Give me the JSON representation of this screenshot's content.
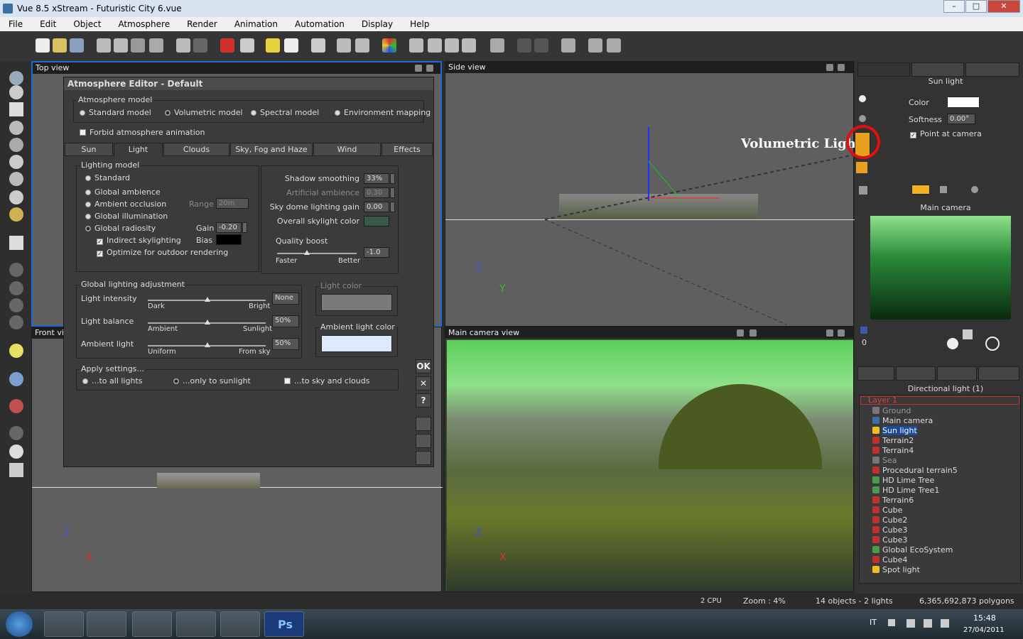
{
  "window": {
    "title": "Vue 8.5 xStream - Futuristic City 6.vue",
    "min": "–",
    "max": "□",
    "close": "✕"
  },
  "menu": [
    "File",
    "Edit",
    "Object",
    "Atmosphere",
    "Render",
    "Animation",
    "Automation",
    "Display",
    "Help"
  ],
  "viewports": {
    "top": "Top view",
    "side": "Side view",
    "front": "Front vie",
    "camera": "Main camera view"
  },
  "axes": {
    "z": "Z",
    "x": "X",
    "y": "Y"
  },
  "dialog": {
    "title": "Atmosphere Editor - Default",
    "model_group": "Atmosphere model",
    "models": [
      "Standard model",
      "Volumetric model",
      "Spectral model",
      "Environment mapping"
    ],
    "forbid": "Forbid atmosphere animation",
    "tabs": [
      "Sun",
      "Light",
      "Clouds",
      "Sky, Fog and Haze",
      "Wind",
      "Effects"
    ],
    "lighting_model": "Lighting model",
    "lm_options": [
      "Standard",
      "Global ambience",
      "Ambient occlusion",
      "Global illumination",
      "Global radiosity"
    ],
    "range_label": "Range",
    "range_value": "20m",
    "gain_label": "Gain",
    "gain_value": "-0.20",
    "indirect": "Indirect skylighting",
    "bias_label": "Bias",
    "optimize": "Optimize for outdoor rendering",
    "shadow_label": "Shadow smoothing",
    "shadow_value": "33%",
    "artificial_label": "Artificial ambience",
    "artificial_value": "0.30",
    "skydome_label": "Sky dome lighting gain",
    "skydome_value": "0.00",
    "skylight_label": "Overall skylight color",
    "quality_label": "Quality boost",
    "quality_value": "-1.0",
    "faster": "Faster",
    "better": "Better",
    "gla": "Global lighting adjustment",
    "intensity_label": "Light intensity",
    "intensity_value": "None",
    "dark": "Dark",
    "bright": "Bright",
    "balance_label": "Light balance",
    "balance_value": "50%",
    "ambient_word": "Ambient",
    "sunlight_word": "Sunlight",
    "ambient_label": "Ambient light",
    "ambient_value": "50%",
    "uniform": "Uniform",
    "fromsky": "From sky",
    "light_color": "Light color",
    "ambient_color": "Ambient light color",
    "apply": "Apply settings...",
    "apply_opts": [
      "...to all lights",
      "...only to sunlight",
      "...to sky and clouds"
    ],
    "ok": "OK",
    "cancel": "✕",
    "help": "?"
  },
  "annotation": "Volumetric Light",
  "right": {
    "sun_title": "Sun light",
    "color_label": "Color",
    "softness_label": "Softness",
    "softness_value": "0.00°",
    "point_camera": "Point at camera",
    "camera_title": "Main camera",
    "dl_title": "Directional light (1)",
    "counter": "0",
    "layer": "Layer 1",
    "tree": [
      "Ground",
      "Main camera",
      "Sun light",
      "Terrain2",
      "Terrain4",
      "Sea",
      "Procedural terrain5",
      "HD Lime Tree",
      "HD Lime Tree1",
      "Terrain6",
      "Cube",
      "Cube2",
      "Cube3",
      "Cube3",
      "Global EcoSystem",
      "Cube4",
      "Spot light"
    ]
  },
  "status": {
    "cpu": "2 CPU",
    "zoom": "Zoom : 4%",
    "objects": "14 objects - 2 lights",
    "polygons": "6,365,692,873 polygons"
  },
  "tray": {
    "lang": "IT",
    "time": "15:48",
    "date": "27/04/2011"
  },
  "colors": {
    "accent": "#1a6ad8",
    "highlight_ring": "#e01010",
    "sun_orange": "#f0a020"
  }
}
